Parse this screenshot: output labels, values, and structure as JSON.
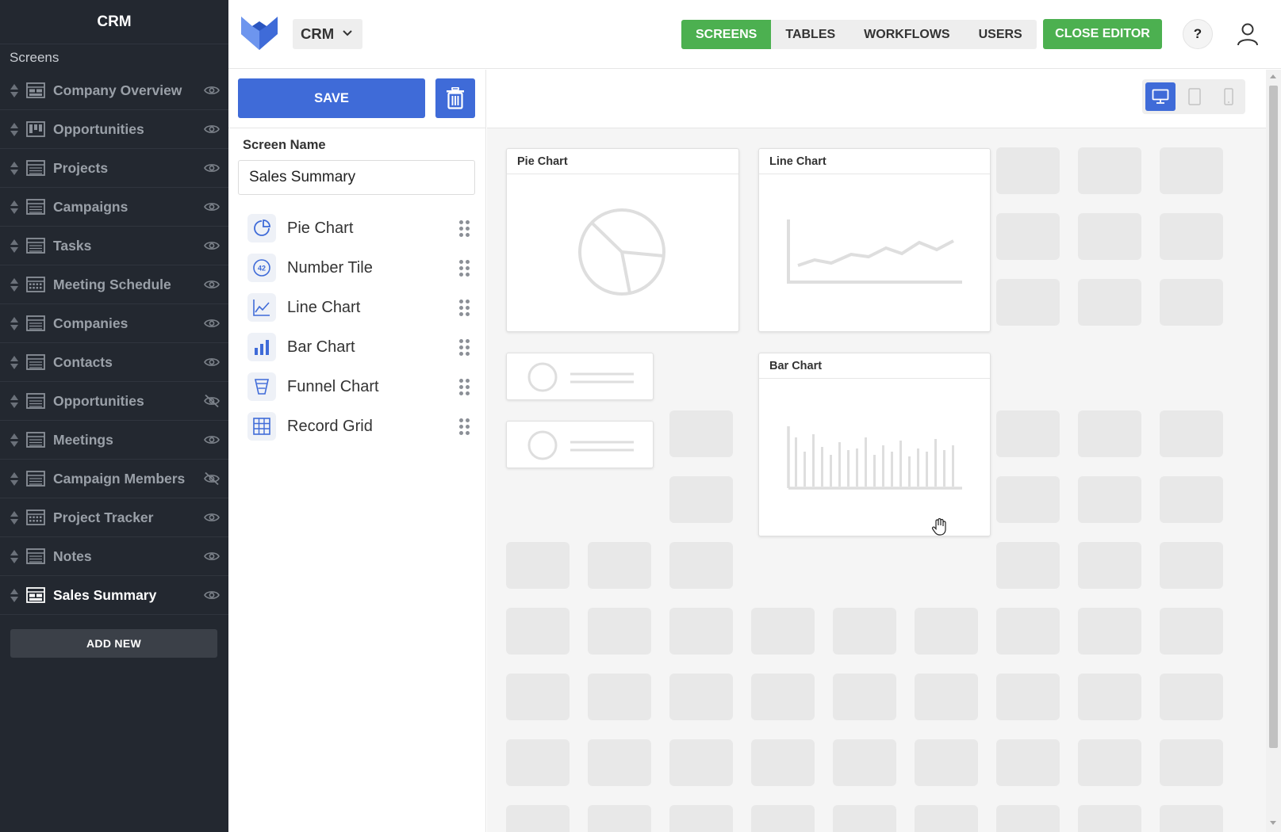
{
  "sidebar": {
    "app_title": "CRM",
    "section_title": "Screens",
    "items": [
      {
        "label": "Company Overview",
        "icon": "dashboard-icon",
        "visible": true
      },
      {
        "label": "Opportunities",
        "icon": "kanban-icon",
        "visible": true
      },
      {
        "label": "Projects",
        "icon": "table-icon",
        "visible": true
      },
      {
        "label": "Campaigns",
        "icon": "table-icon",
        "visible": true
      },
      {
        "label": "Tasks",
        "icon": "table-icon",
        "visible": true
      },
      {
        "label": "Meeting Schedule",
        "icon": "calendar-icon",
        "visible": true
      },
      {
        "label": "Companies",
        "icon": "table-icon",
        "visible": true
      },
      {
        "label": "Contacts",
        "icon": "table-icon",
        "visible": true
      },
      {
        "label": "Opportunities",
        "icon": "table-icon",
        "visible": false
      },
      {
        "label": "Meetings",
        "icon": "table-icon",
        "visible": true
      },
      {
        "label": "Campaign Members",
        "icon": "table-icon",
        "visible": false
      },
      {
        "label": "Project Tracker",
        "icon": "calendar-icon",
        "visible": true
      },
      {
        "label": "Notes",
        "icon": "table-icon",
        "visible": true
      },
      {
        "label": "Sales Summary",
        "icon": "dashboard-icon",
        "visible": true,
        "active": true
      }
    ],
    "add_new_label": "ADD NEW"
  },
  "topbar": {
    "app_selector": "CRM",
    "tabs": [
      {
        "label": "SCREENS",
        "active": true
      },
      {
        "label": "TABLES",
        "active": false
      },
      {
        "label": "WORKFLOWS",
        "active": false
      },
      {
        "label": "USERS",
        "active": false
      }
    ],
    "close_editor_label": "CLOSE EDITOR",
    "help_label": "?"
  },
  "panel": {
    "save_label": "SAVE",
    "screen_name_label": "Screen Name",
    "screen_name_value": "Sales Summary",
    "widgets": [
      {
        "label": "Pie Chart",
        "icon": "pie-chart-icon"
      },
      {
        "label": "Number Tile",
        "icon": "number-tile-icon",
        "icon_text": "42"
      },
      {
        "label": "Line Chart",
        "icon": "line-chart-icon"
      },
      {
        "label": "Bar Chart",
        "icon": "bar-chart-icon"
      },
      {
        "label": "Funnel Chart",
        "icon": "funnel-chart-icon"
      },
      {
        "label": "Record Grid",
        "icon": "grid-icon"
      }
    ]
  },
  "canvas": {
    "device_modes": [
      "desktop",
      "tablet",
      "mobile"
    ],
    "active_device": "desktop",
    "widgets": {
      "pie_title": "Pie Chart",
      "line_title": "Line Chart",
      "bar_title": "Bar Chart"
    }
  },
  "colors": {
    "sidebar_bg": "#232830",
    "primary_blue": "#3f6bd8",
    "accent_green": "#4cb050",
    "slot_gray": "#e8e8e8",
    "placeholder_gray": "#dedede"
  }
}
